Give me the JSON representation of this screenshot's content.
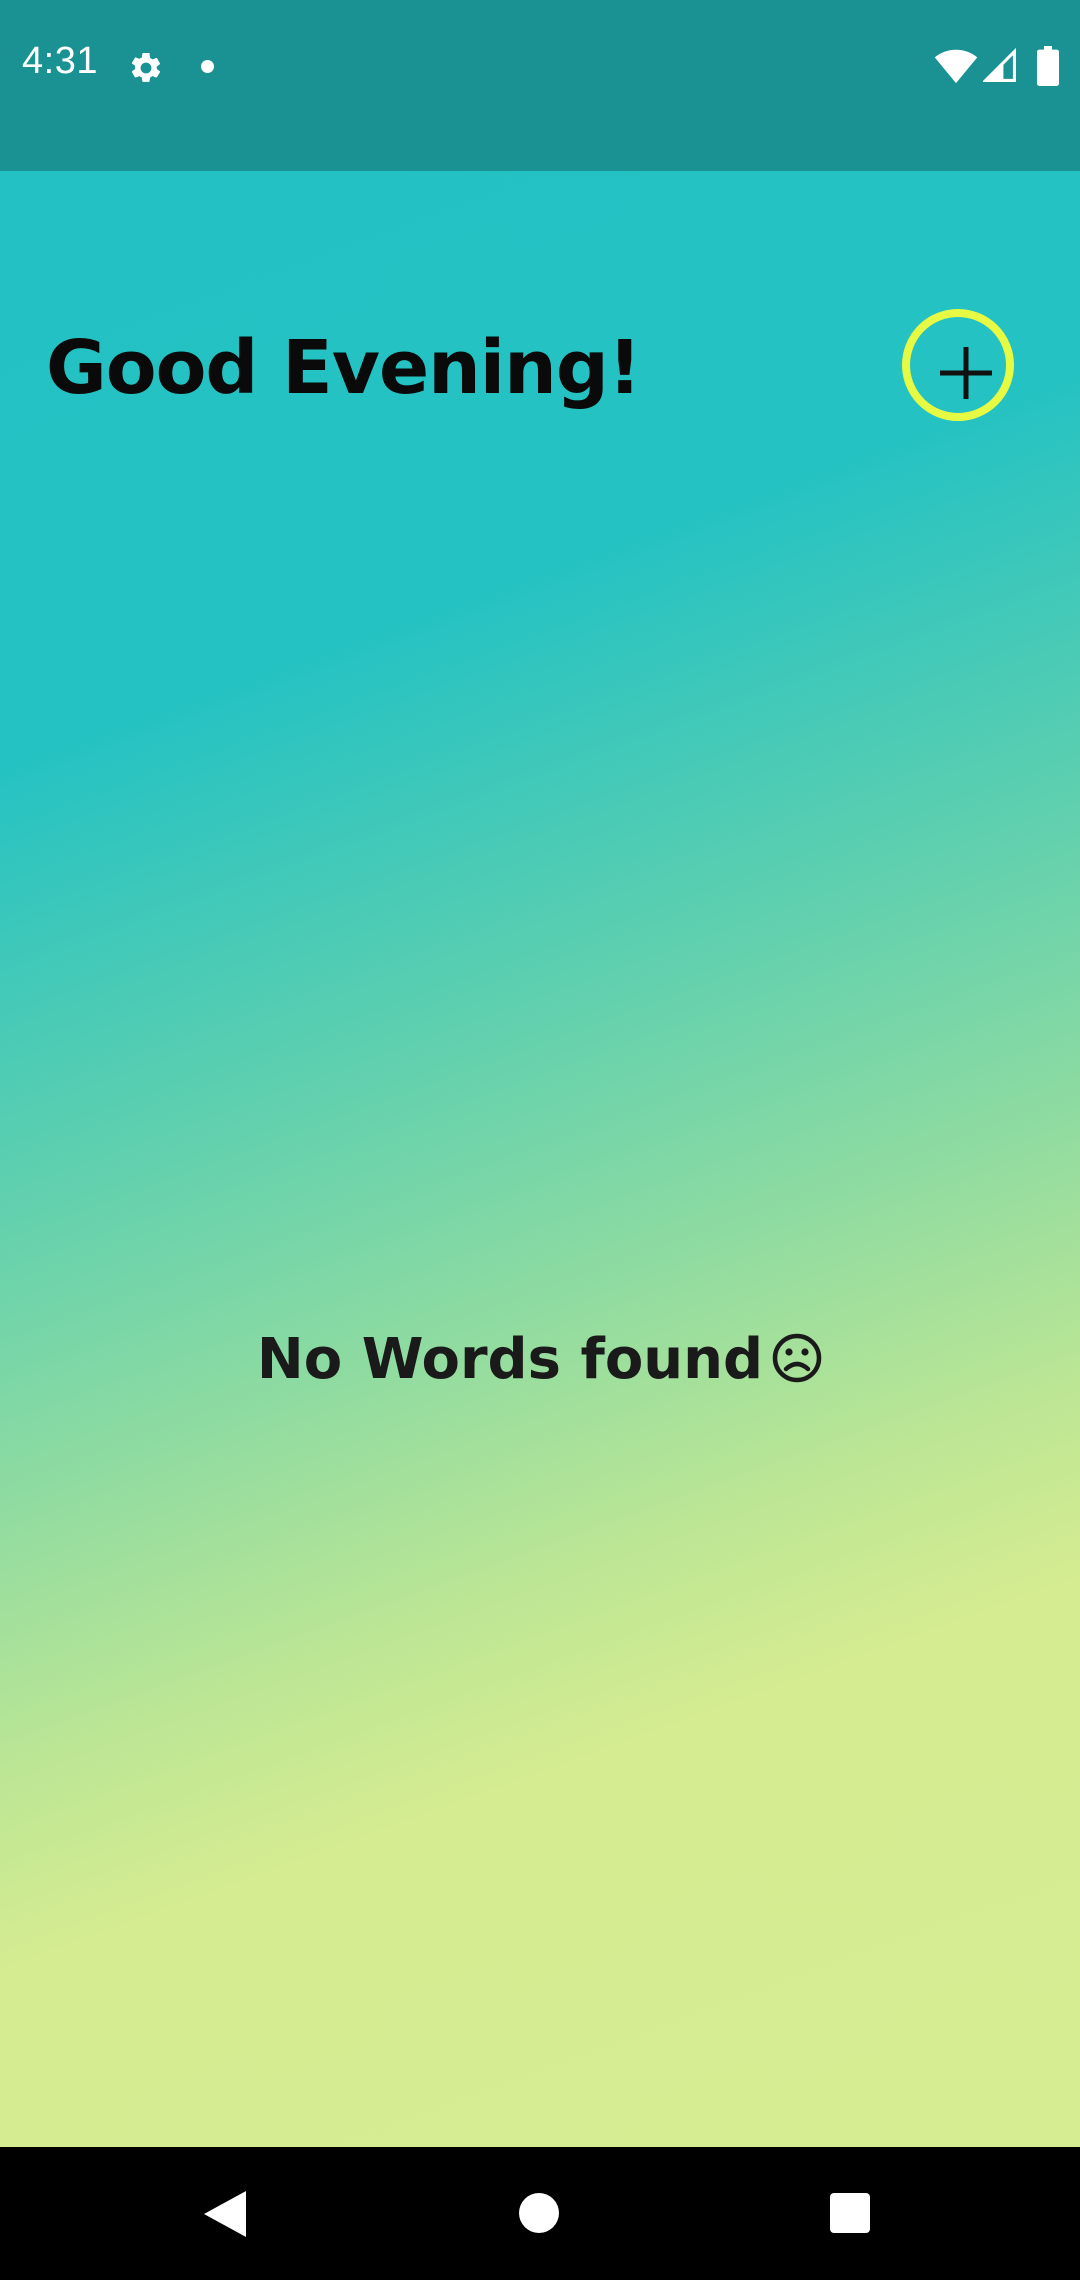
{
  "status_bar": {
    "time": "4:31",
    "background_color": "#1A9293",
    "icons": [
      "gear-icon",
      "notification-dot-icon",
      "wifi-icon",
      "signal-icon",
      "battery-icon"
    ]
  },
  "main": {
    "greeting": "Good Evening!",
    "add_button_icon": "plus-icon",
    "add_button_ring_color": "#E6FA44",
    "empty_message": "No Words found",
    "empty_message_icon": "sad-face-icon",
    "gradient_colors": [
      "#23C1C3",
      "#D6ED92"
    ]
  },
  "nav_bar": {
    "icons": [
      "back-icon",
      "home-icon",
      "recents-icon"
    ]
  }
}
